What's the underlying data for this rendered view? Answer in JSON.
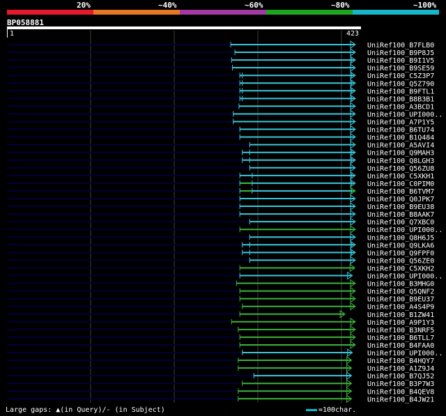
{
  "legend": {
    "labels": [
      "20%",
      "~40%",
      "~60%",
      "~80%",
      "~100%"
    ],
    "colors": [
      "#e8192c",
      "#e87722",
      "#a23aa2",
      "#1fa61f",
      "#14b8c8"
    ]
  },
  "query": {
    "id": "BP058881",
    "start": "1",
    "end": "423",
    "length": 423
  },
  "colors": {
    "cyan": "#3cc8dc",
    "green": "#3cb43c",
    "track": "#00003a",
    "grid": "#404040"
  },
  "hits": [
    {
      "name": "UniRef100_B7FLB0",
      "start": 273,
      "end": 427,
      "color": "cyan",
      "marks": []
    },
    {
      "name": "UniRef100_B9P8J5",
      "start": 278,
      "end": 427,
      "color": "cyan",
      "marks": []
    },
    {
      "name": "UniRef100_B9I1V5",
      "start": 274,
      "end": 427,
      "color": "cyan",
      "marks": [
        420
      ]
    },
    {
      "name": "UniRef100_B9SE59",
      "start": 275,
      "end": 427,
      "color": "cyan",
      "marks": []
    },
    {
      "name": "UniRef100_C5Z3P7",
      "start": 284,
      "end": 427,
      "color": "cyan",
      "marks": [
        287,
        420
      ]
    },
    {
      "name": "UniRef100_Q5Z790",
      "start": 284,
      "end": 427,
      "color": "cyan",
      "marks": [
        287,
        420
      ]
    },
    {
      "name": "UniRef100_B9FTL1",
      "start": 284,
      "end": 427,
      "color": "cyan",
      "marks": [
        287,
        420
      ]
    },
    {
      "name": "UniRef100_B8B3B1",
      "start": 284,
      "end": 427,
      "color": "cyan",
      "marks": [
        287,
        420
      ]
    },
    {
      "name": "UniRef100_A3BCD1",
      "start": 283,
      "end": 427,
      "color": "cyan",
      "marks": []
    },
    {
      "name": "UniRef100_UPI000..",
      "start": 276,
      "end": 427,
      "color": "cyan",
      "marks": []
    },
    {
      "name": "UniRef100_A7P1Y5",
      "start": 276,
      "end": 427,
      "color": "cyan",
      "marks": []
    },
    {
      "name": "UniRef100_B6TU74",
      "start": 284,
      "end": 427,
      "color": "cyan",
      "marks": []
    },
    {
      "name": "UniRef100_B1Q484",
      "start": 284,
      "end": 427,
      "color": "cyan",
      "marks": []
    },
    {
      "name": "UniRef100_A5AVI4",
      "start": 296,
      "end": 427,
      "color": "cyan",
      "marks": []
    },
    {
      "name": "UniRef100_Q9MAH3",
      "start": 287,
      "end": 427,
      "color": "cyan",
      "marks": [
        296,
        420
      ]
    },
    {
      "name": "UniRef100_Q8LGH3",
      "start": 287,
      "end": 427,
      "color": "cyan",
      "marks": [
        296,
        420
      ]
    },
    {
      "name": "UniRef100_Q56ZU8",
      "start": 296,
      "end": 427,
      "color": "cyan",
      "marks": []
    },
    {
      "name": "UniRef100_C5XKH1",
      "start": 284,
      "end": 427,
      "color": "cyan",
      "marks": [
        299,
        420
      ]
    },
    {
      "name": "UniRef100_C0PIM0",
      "start": 284,
      "end": 427,
      "color": "cyan",
      "marks": [
        299,
        420
      ],
      "segments": [
        {
          "from": 284,
          "to": 299,
          "color": "green"
        }
      ]
    },
    {
      "name": "UniRef100_B6TVM7",
      "start": 284,
      "end": 427,
      "color": "cyan",
      "marks": [
        299,
        420
      ],
      "segments": [
        {
          "from": 284,
          "to": 299,
          "color": "green"
        },
        {
          "from": 420,
          "to": 427,
          "color": "green"
        }
      ]
    },
    {
      "name": "UniRef100_Q0JPK7",
      "start": 284,
      "end": 427,
      "color": "cyan",
      "marks": []
    },
    {
      "name": "UniRef100_B9EU38",
      "start": 284,
      "end": 427,
      "color": "cyan",
      "marks": []
    },
    {
      "name": "UniRef100_B8AAK7",
      "start": 284,
      "end": 427,
      "color": "cyan",
      "marks": []
    },
    {
      "name": "UniRef100_Q7XBC0",
      "start": 296,
      "end": 427,
      "color": "cyan",
      "marks": []
    },
    {
      "name": "UniRef100_UPI000..",
      "start": 284,
      "end": 427,
      "color": "green",
      "marks": []
    },
    {
      "name": "UniRef100_Q8H6J5",
      "start": 296,
      "end": 427,
      "color": "cyan",
      "marks": []
    },
    {
      "name": "UniRef100_Q9LKA6",
      "start": 287,
      "end": 427,
      "color": "cyan",
      "marks": [
        296,
        420
      ]
    },
    {
      "name": "UniRef100_Q9FPF0",
      "start": 287,
      "end": 427,
      "color": "cyan",
      "marks": [
        296,
        420
      ]
    },
    {
      "name": "UniRef100_Q56ZE0",
      "start": 296,
      "end": 427,
      "color": "cyan",
      "marks": []
    },
    {
      "name": "UniRef100_C5XKH2",
      "start": 284,
      "end": 423,
      "color": "green",
      "marks": []
    },
    {
      "name": "UniRef100_UPI000..",
      "start": 284,
      "end": 420,
      "color": "cyan",
      "marks": []
    },
    {
      "name": "UniRef100_B3MHG0",
      "start": 280,
      "end": 427,
      "color": "green",
      "marks": []
    },
    {
      "name": "UniRef100_Q5QNF2",
      "start": 284,
      "end": 427,
      "color": "green",
      "marks": []
    },
    {
      "name": "UniRef100_B9EU37",
      "start": 284,
      "end": 427,
      "color": "green",
      "marks": []
    },
    {
      "name": "UniRef100_A4S4P9",
      "start": 287,
      "end": 427,
      "color": "green",
      "marks": []
    },
    {
      "name": "UniRef100_B1ZW41",
      "start": 284,
      "end": 411,
      "color": "green",
      "marks": []
    },
    {
      "name": "UniRef100_A9P1Y3",
      "start": 274,
      "end": 427,
      "color": "green",
      "marks": []
    },
    {
      "name": "UniRef100_B3NRF5",
      "start": 282,
      "end": 427,
      "color": "green",
      "marks": []
    },
    {
      "name": "UniRef100_B6TLL7",
      "start": 284,
      "end": 427,
      "color": "green",
      "marks": []
    },
    {
      "name": "UniRef100_B4FAA0",
      "start": 284,
      "end": 427,
      "color": "green",
      "marks": []
    },
    {
      "name": "UniRef100_UPI000..",
      "start": 287,
      "end": 420,
      "color": "cyan",
      "marks": []
    },
    {
      "name": "UniRef100_B4HQY7",
      "start": 282,
      "end": 419,
      "color": "green",
      "marks": []
    },
    {
      "name": "UniRef100_A1Z9J4",
      "start": 282,
      "end": 419,
      "color": "green",
      "marks": []
    },
    {
      "name": "UniRef100_B7QJ52",
      "start": 301,
      "end": 419,
      "color": "cyan",
      "marks": []
    },
    {
      "name": "UniRef100_B3P7W3",
      "start": 287,
      "end": 419,
      "color": "green",
      "marks": []
    },
    {
      "name": "UniRef100_B4QEV8",
      "start": 282,
      "end": 419,
      "color": "green",
      "marks": []
    },
    {
      "name": "UniRef100_B4JW21",
      "start": 282,
      "end": 419,
      "color": "green",
      "marks": []
    }
  ],
  "footer": {
    "gaps_text": "Large gaps: ▲(in Query)/- (in Subject)",
    "scale_text": "=100char."
  }
}
